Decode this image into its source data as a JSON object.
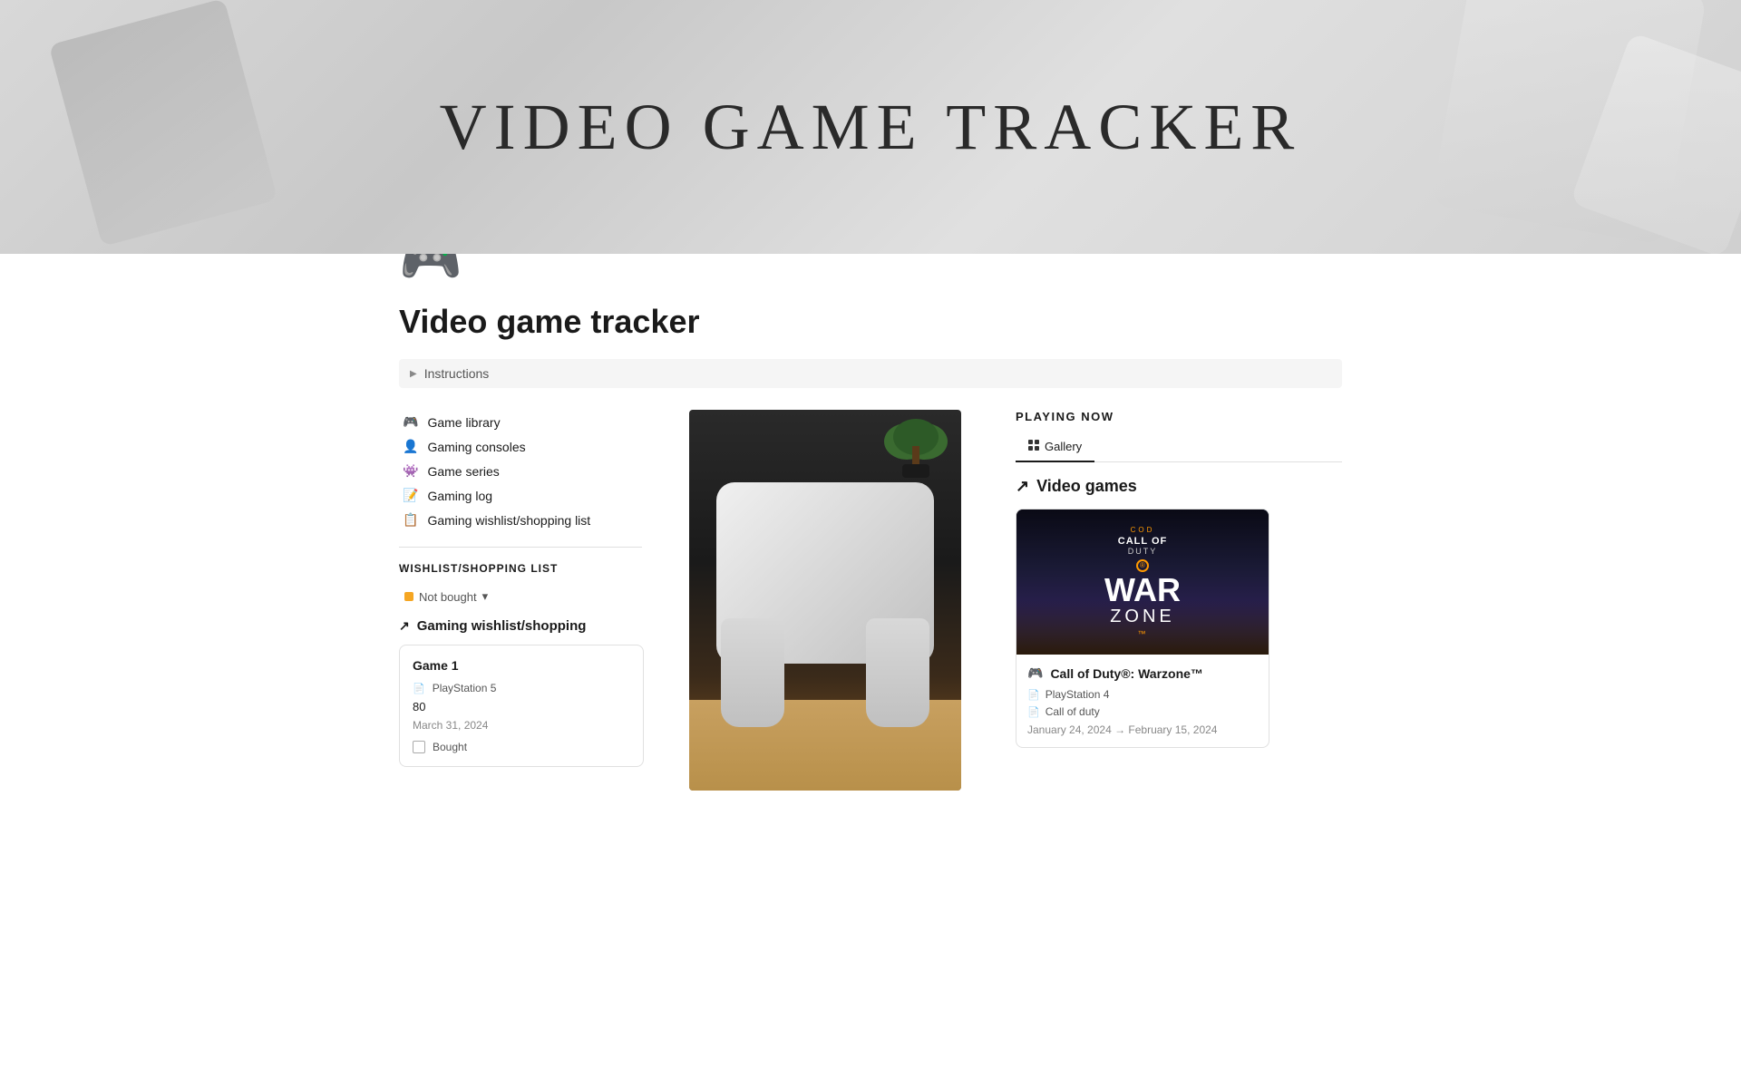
{
  "cover": {
    "title": "VIDEO GAME TRACKER"
  },
  "page": {
    "icon": "🎮",
    "title": "Video game tracker"
  },
  "instructions": {
    "label": "Instructions"
  },
  "nav": {
    "items": [
      {
        "id": "game-library",
        "icon": "🎮",
        "label": "Game library"
      },
      {
        "id": "gaming-consoles",
        "icon": "👤",
        "label": "Gaming consoles"
      },
      {
        "id": "game-series",
        "icon": "👾",
        "label": "Game series"
      },
      {
        "id": "gaming-log",
        "icon": "📝",
        "label": "Gaming log"
      },
      {
        "id": "gaming-wishlist",
        "icon": "📋",
        "label": "Gaming wishlist/shopping list"
      }
    ]
  },
  "wishlist": {
    "section_title": "WISHLIST/SHOPPING LIST",
    "filter_label": "Not bought",
    "link_label": "Gaming wishlist/shopping",
    "card": {
      "title": "Game 1",
      "console": "PlayStation 5",
      "price": "80",
      "date": "March 31, 2024",
      "bought_label": "Bought"
    }
  },
  "playing_now": {
    "section_title": "PLAYING NOW",
    "tab_gallery": "Gallery",
    "link_label": "Video games",
    "game": {
      "name": "Call of Duty®: Warzone™",
      "console": "PlayStation 4",
      "series": "Call of duty",
      "dates": "January 24, 2024 → February 15, 2024",
      "warzone_label": "WAR ZONE",
      "cod_label": "COD",
      "call_label": "CALL OF",
      "duty_label": "DUTY"
    }
  }
}
